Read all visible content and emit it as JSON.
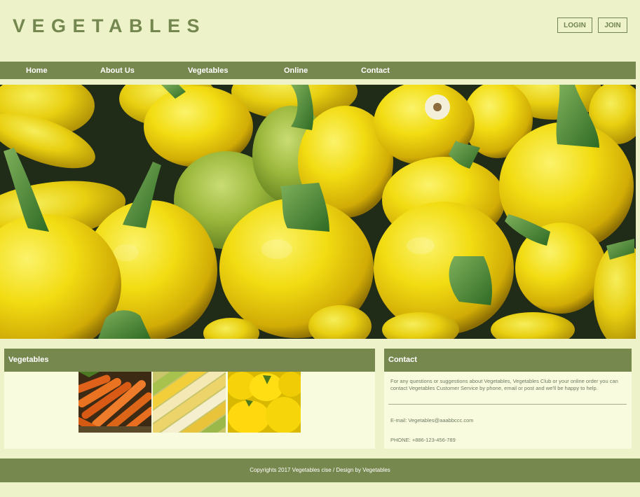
{
  "brand": {
    "logo_text": "VEGETABLES"
  },
  "auth": {
    "login_label": "LOGIN",
    "join_label": "JOIN"
  },
  "nav": {
    "items": [
      {
        "label": "Home"
      },
      {
        "label": "About Us"
      },
      {
        "label": "Vegetables"
      },
      {
        "label": "Online"
      },
      {
        "label": "Contact"
      }
    ]
  },
  "hero": {
    "subject": "yellow round zucchini"
  },
  "vegetables_panel": {
    "title": "Vegetables",
    "images": [
      "carrots",
      "corn",
      "yellow peppers"
    ]
  },
  "contact_panel": {
    "title": "Contact",
    "description": "For any questions or suggestions about Vegetables, Vegetables Club or your online order you can contact Vegetables Customer Service by phone, email or post and we'll be happy to help.",
    "email": "E-mail: Vegetables@aaabbccc.com",
    "phone": "PHONE: +886-123-456-789"
  },
  "footer": {
    "copyright": "Copyrights 2017 Vegetables cise / Design by Vegetables"
  },
  "colors": {
    "background": "#edf2c8",
    "accent": "#77884e",
    "panel": "#f8fbde"
  }
}
